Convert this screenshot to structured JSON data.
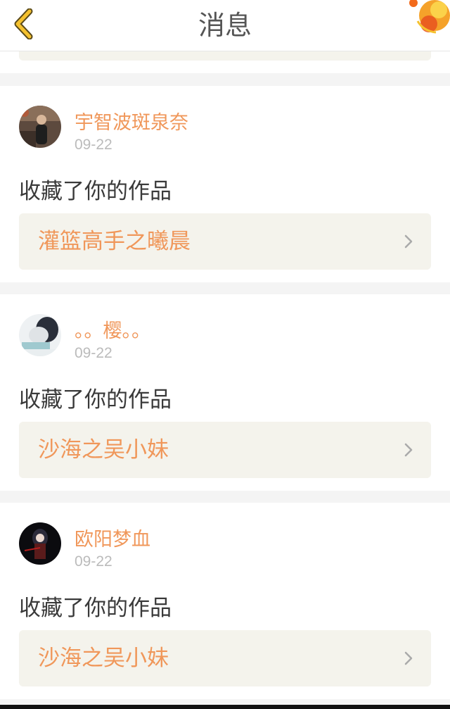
{
  "header": {
    "title": "消息",
    "back_icon": "chevron-left-icon",
    "back_color": "#f5c12e"
  },
  "colors": {
    "accent": "#f0975a",
    "date": "#bbbbbb",
    "work_bg": "#f4f3ec",
    "page_bg": "#f4f4f4"
  },
  "messages": [
    {
      "username": "宇智波斑泉奈",
      "date": "09-22",
      "action": "收藏了你的作品",
      "work_title": "灌篮高手之曦晨"
    },
    {
      "username": "。。樱。。",
      "date": "09-22",
      "action": "收藏了你的作品",
      "work_title": "沙海之吴小妹"
    },
    {
      "username": "欧阳梦血",
      "date": "09-22",
      "action": "收藏了你的作品",
      "work_title": "沙海之吴小妹"
    }
  ]
}
